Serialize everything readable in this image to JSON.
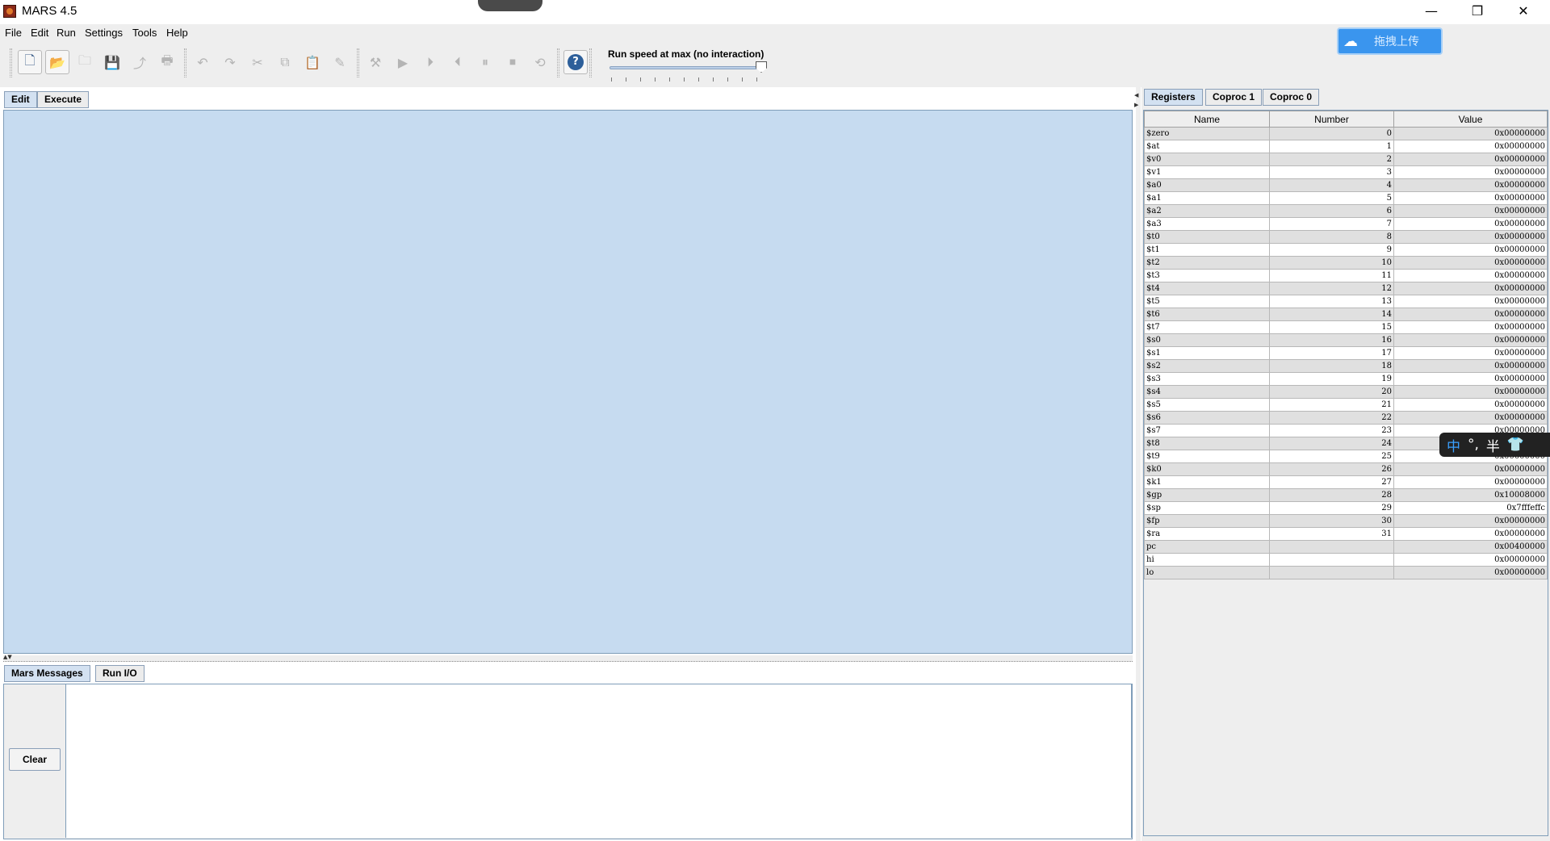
{
  "window": {
    "title": "MARS 4.5",
    "minimize": "—",
    "restore": "❐",
    "close": "✕"
  },
  "menubar": [
    "File",
    "Edit",
    "Run",
    "Settings",
    "Tools",
    "Help"
  ],
  "toolbar": {
    "speed_label": "Run speed at max (no interaction)",
    "speed_level": 1.0,
    "buttons": [
      {
        "name": "new-file",
        "icon": "🗋",
        "enabled": true
      },
      {
        "name": "open-file",
        "icon": "📂",
        "enabled": true
      },
      {
        "name": "close-file",
        "icon": "🗀",
        "enabled": false
      },
      {
        "name": "save-file",
        "icon": "💾",
        "enabled": false
      },
      {
        "name": "dump-memory",
        "icon": "⤴",
        "enabled": false
      },
      {
        "name": "print",
        "icon": "🖶",
        "enabled": false
      },
      {
        "name": "undo",
        "icon": "↶",
        "enabled": false
      },
      {
        "name": "redo",
        "icon": "↷",
        "enabled": false
      },
      {
        "name": "cut",
        "icon": "✂",
        "enabled": false
      },
      {
        "name": "copy",
        "icon": "⧉",
        "enabled": false
      },
      {
        "name": "paste",
        "icon": "📋",
        "enabled": false
      },
      {
        "name": "find-replace",
        "icon": "✎",
        "enabled": false
      },
      {
        "name": "assemble",
        "icon": "⚒",
        "enabled": false
      },
      {
        "name": "run",
        "icon": "▶",
        "enabled": false
      },
      {
        "name": "step",
        "icon": "⏵",
        "enabled": false
      },
      {
        "name": "backstep",
        "icon": "⏴",
        "enabled": false
      },
      {
        "name": "pause",
        "icon": "⏸",
        "enabled": false
      },
      {
        "name": "stop",
        "icon": "⏹",
        "enabled": false
      },
      {
        "name": "reset",
        "icon": "⟲",
        "enabled": false
      },
      {
        "name": "help",
        "icon": "?",
        "enabled": true
      }
    ]
  },
  "upload_badge": {
    "text": "拖拽上传",
    "icon": "cloud-icon"
  },
  "editor": {
    "tabs": [
      "Edit",
      "Execute"
    ]
  },
  "messages": {
    "tabs": [
      "Mars Messages",
      "Run I/O"
    ],
    "clear_label": "Clear"
  },
  "registers": {
    "tabs": [
      "Registers",
      "Coproc 1",
      "Coproc 0"
    ],
    "headers": [
      "Name",
      "Number",
      "Value"
    ],
    "rows": [
      [
        "$zero",
        "0",
        "0x00000000"
      ],
      [
        "$at",
        "1",
        "0x00000000"
      ],
      [
        "$v0",
        "2",
        "0x00000000"
      ],
      [
        "$v1",
        "3",
        "0x00000000"
      ],
      [
        "$a0",
        "4",
        "0x00000000"
      ],
      [
        "$a1",
        "5",
        "0x00000000"
      ],
      [
        "$a2",
        "6",
        "0x00000000"
      ],
      [
        "$a3",
        "7",
        "0x00000000"
      ],
      [
        "$t0",
        "8",
        "0x00000000"
      ],
      [
        "$t1",
        "9",
        "0x00000000"
      ],
      [
        "$t2",
        "10",
        "0x00000000"
      ],
      [
        "$t3",
        "11",
        "0x00000000"
      ],
      [
        "$t4",
        "12",
        "0x00000000"
      ],
      [
        "$t5",
        "13",
        "0x00000000"
      ],
      [
        "$t6",
        "14",
        "0x00000000"
      ],
      [
        "$t7",
        "15",
        "0x00000000"
      ],
      [
        "$s0",
        "16",
        "0x00000000"
      ],
      [
        "$s1",
        "17",
        "0x00000000"
      ],
      [
        "$s2",
        "18",
        "0x00000000"
      ],
      [
        "$s3",
        "19",
        "0x00000000"
      ],
      [
        "$s4",
        "20",
        "0x00000000"
      ],
      [
        "$s5",
        "21",
        "0x00000000"
      ],
      [
        "$s6",
        "22",
        "0x00000000"
      ],
      [
        "$s7",
        "23",
        "0x00000000"
      ],
      [
        "$t8",
        "24",
        "0x00000000"
      ],
      [
        "$t9",
        "25",
        "0x00000000"
      ],
      [
        "$k0",
        "26",
        "0x00000000"
      ],
      [
        "$k1",
        "27",
        "0x00000000"
      ],
      [
        "$gp",
        "28",
        "0x10008000"
      ],
      [
        "$sp",
        "29",
        "0x7fffeffc"
      ],
      [
        "$fp",
        "30",
        "0x00000000"
      ],
      [
        "$ra",
        "31",
        "0x00000000"
      ],
      [
        "pc",
        "",
        "0x00400000"
      ],
      [
        "hi",
        "",
        "0x00000000"
      ],
      [
        "lo",
        "",
        "0x00000000"
      ]
    ]
  },
  "ime_bar": {
    "items": [
      "中",
      "°,",
      "半",
      "👕"
    ]
  }
}
